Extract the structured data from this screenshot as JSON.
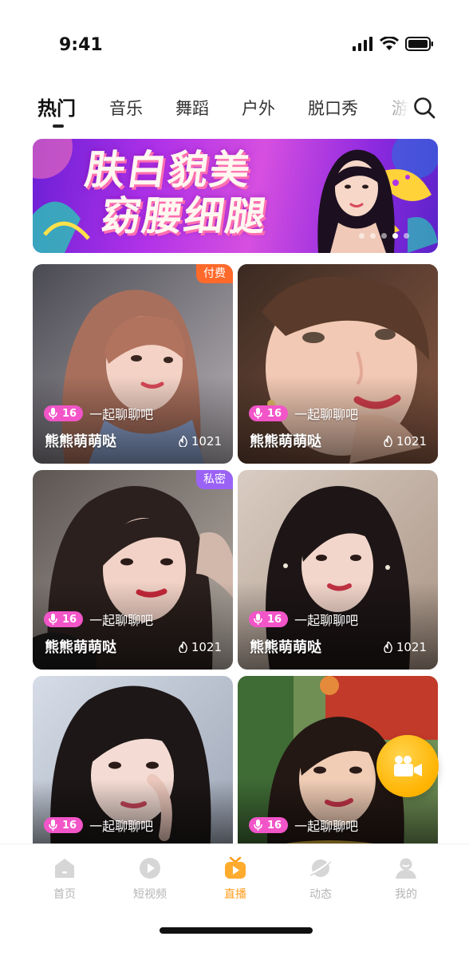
{
  "status_bar": {
    "time": "9:41"
  },
  "tabs": [
    {
      "label": "热门",
      "active": true
    },
    {
      "label": "音乐",
      "active": false
    },
    {
      "label": "舞蹈",
      "active": false
    },
    {
      "label": "户外",
      "active": false
    },
    {
      "label": "脱口秀",
      "active": false
    },
    {
      "label": "游",
      "active": false
    }
  ],
  "search_icon": "search-icon",
  "banner": {
    "title_line1": "肤白貌美",
    "title_line2": "窈腰细腿",
    "slide_count": 5,
    "active_slide": 4
  },
  "cards": [
    {
      "tag": "付费",
      "tag_color": "#ff6a2b",
      "topic_count": "16",
      "topic": "一起聊聊吧",
      "name": "熊熊萌萌哒",
      "heat": "1021"
    },
    {
      "tag": "",
      "tag_color": "",
      "topic_count": "16",
      "topic": "一起聊聊吧",
      "name": "熊熊萌萌哒",
      "heat": "1021"
    },
    {
      "tag": "私密",
      "tag_color": "#9b63f5",
      "topic_count": "16",
      "topic": "一起聊聊吧",
      "name": "熊熊萌萌哒",
      "heat": "1021"
    },
    {
      "tag": "",
      "tag_color": "",
      "topic_count": "16",
      "topic": "一起聊聊吧",
      "name": "熊熊萌萌哒",
      "heat": "1021"
    },
    {
      "tag": "",
      "tag_color": "",
      "topic_count": "16",
      "topic": "一起聊聊吧",
      "name": "",
      "heat": ""
    },
    {
      "tag": "",
      "tag_color": "",
      "topic_count": "16",
      "topic": "一起聊聊吧",
      "name": "",
      "heat": ""
    }
  ],
  "nav": [
    {
      "label": "首页",
      "icon": "home-icon",
      "active": false
    },
    {
      "label": "短视频",
      "icon": "play-icon",
      "active": false
    },
    {
      "label": "直播",
      "icon": "live-tv-icon",
      "active": true
    },
    {
      "label": "动态",
      "icon": "planet-icon",
      "active": false
    },
    {
      "label": "我的",
      "icon": "user-icon",
      "active": false
    }
  ],
  "colors": {
    "accent": "#ff9c1a",
    "pill": "#f255c8",
    "paid_tag": "#ff6a2b",
    "private_tag": "#9b63f5"
  }
}
